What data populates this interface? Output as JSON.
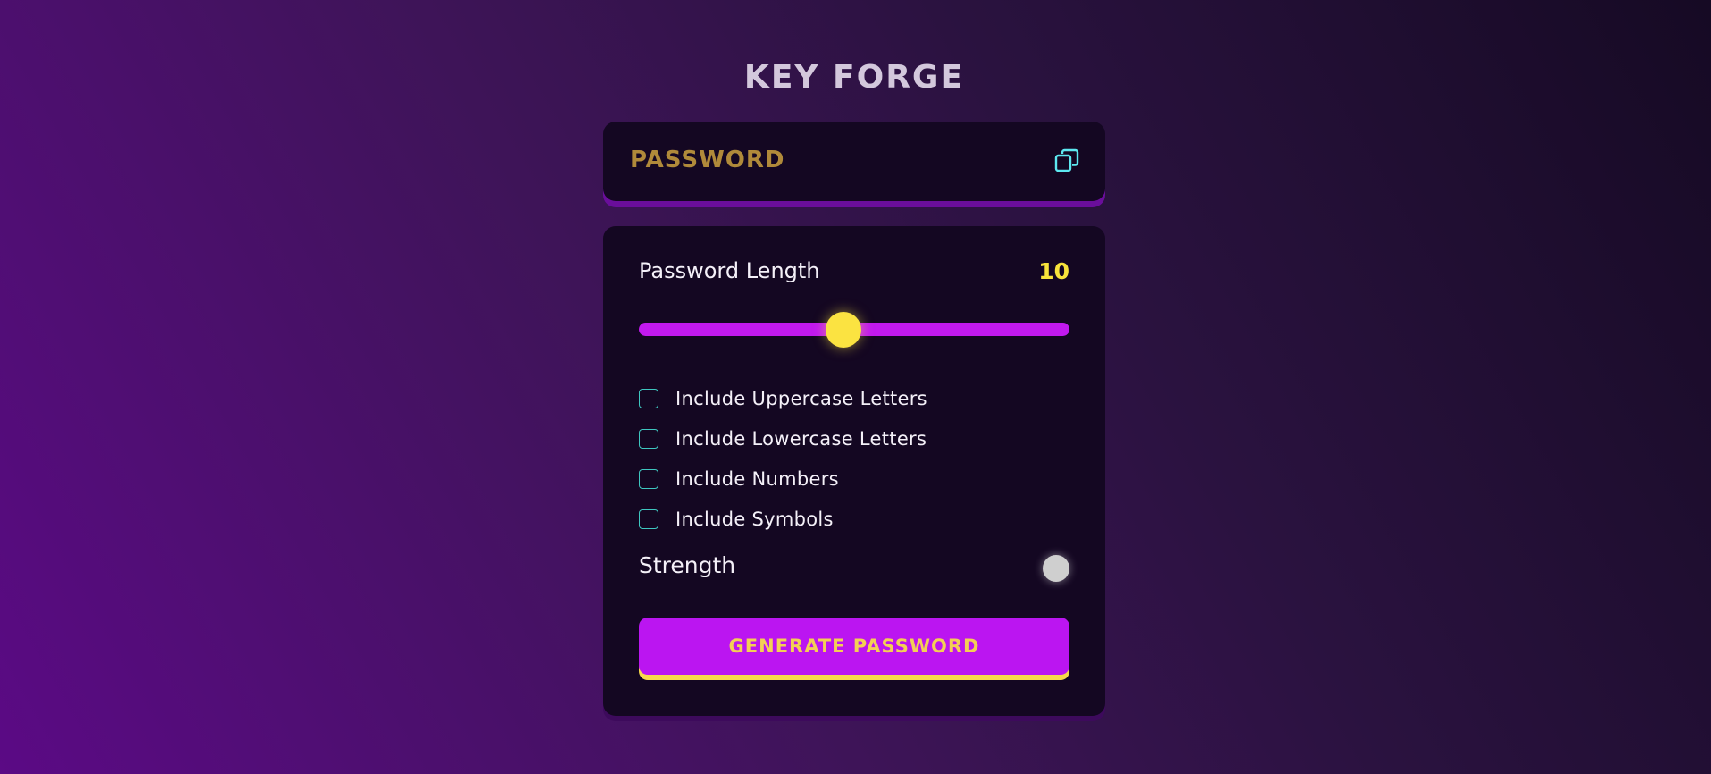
{
  "app": {
    "title": "KEY FORGE"
  },
  "password_display": {
    "value": "PASSWORD"
  },
  "length": {
    "label": "Password Length",
    "value": "10",
    "slider_fraction": 0.475
  },
  "options": [
    {
      "label": "Include Uppercase Letters",
      "checked": false
    },
    {
      "label": "Include Lowercase Letters",
      "checked": false
    },
    {
      "label": "Include Numbers",
      "checked": false
    },
    {
      "label": "Include Symbols",
      "checked": false
    }
  ],
  "strength": {
    "label": "Strength"
  },
  "generate": {
    "label": "GENERATE PASSWORD"
  },
  "colors": {
    "accent_magenta": "#bb15f1",
    "accent_yellow": "#fbe341",
    "checkbox_teal": "#3fc7c0",
    "copy_icon_cyan": "#5de8f0",
    "password_gold": "#b08a3a"
  },
  "icons": {
    "copy": "copy-icon"
  }
}
